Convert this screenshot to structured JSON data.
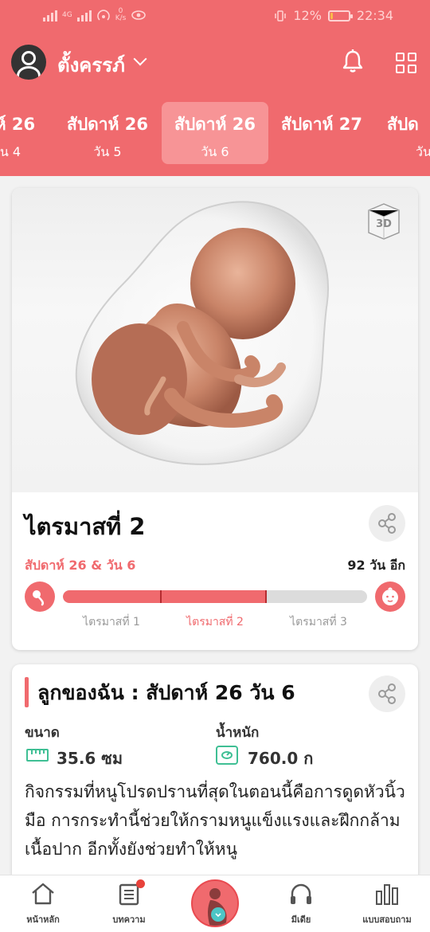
{
  "status_bar": {
    "network_label": "4G",
    "speed_value": "0",
    "speed_unit": "K/s",
    "battery_text": "12%",
    "battery_level": 0.12,
    "time": "22:34"
  },
  "header": {
    "profile_name": "ตั้งครรภ์"
  },
  "week_tabs": [
    {
      "week": "าห์ 26",
      "day": "ัน 4"
    },
    {
      "week": "สัปดาห์ 26",
      "day": "วัน 5"
    },
    {
      "week": "สัปดาห์ 26",
      "day": "วัน 6",
      "active": true
    },
    {
      "week": "สัปดาห์ 27",
      "day": ""
    },
    {
      "week": "สัปด",
      "day": "วัน"
    }
  ],
  "pregnancy_card": {
    "trimester_title": "ไตรมาสที่ 2",
    "progress_left": "สัปดาห์ 26 & วัน 6",
    "progress_right": "92 วัน อีก",
    "progress": 0.67,
    "trimester_labels": [
      "ไตรมาสที่ 1",
      "ไตรมาสที่ 2",
      "ไตรมาสที่ 3"
    ],
    "active_trimester": 1
  },
  "baby_card": {
    "title": "ลูกของฉัน : สัปดาห์ 26 วัน 6",
    "size_label": "ขนาด",
    "size_value": "35.6 ซม",
    "weight_label": "น้ำหนัก",
    "weight_value": "760.0 ก",
    "description": "กิจกรรมที่หนูโปรดปรานที่สุดในตอนนี้คือการดูดหัวนิ้วมือ การกระทำนี้ช่วยให้กรามหนูแข็งแรงและฝึกกล้ามเนื้อปาก อีกทั้งยังช่วยทำให้หนู"
  },
  "tab_bar": {
    "home": "หน้าหลัก",
    "articles": "บทความ",
    "media": "มีเดีย",
    "quiz": "แบบสอบถาม"
  },
  "colors": {
    "brand": "#f06a6e",
    "accent_green": "#3fbf94"
  }
}
